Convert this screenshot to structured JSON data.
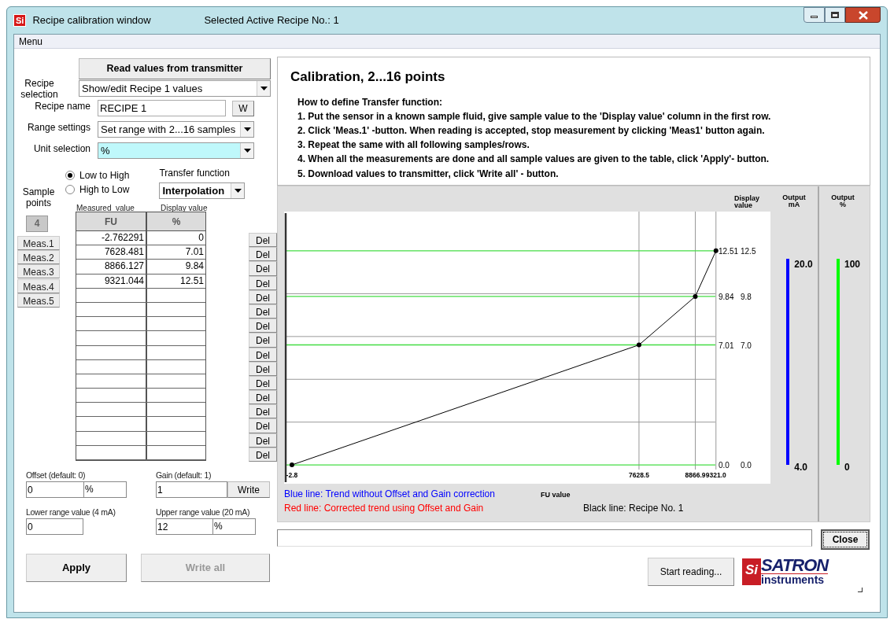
{
  "window": {
    "logo": "Si",
    "title": "Recipe calibration window",
    "subtitle": "Selected Active Recipe No.: 1"
  },
  "menu": [
    "Menu"
  ],
  "read_button": "Read values from transmitter",
  "fields": [
    {
      "kind": "select",
      "label": "Recipe selection",
      "value": "Show/edit Recipe 1 values"
    },
    {
      "kind": "input",
      "label": "Recipe name",
      "value": "RECIPE 1",
      "button": "W"
    },
    {
      "kind": "select",
      "label": "Range settings",
      "value": "Set range with 2...16 samples"
    },
    {
      "kind": "select",
      "label": "Unit selection",
      "value": "%",
      "highlighted": true
    }
  ],
  "direction": [
    {
      "label": "Low to High",
      "selected": true
    },
    {
      "label": "High to Low",
      "selected": false
    }
  ],
  "transfer_function": {
    "label": "Transfer function",
    "value": "Interpolation"
  },
  "sample_points": {
    "label": "Sample points",
    "value": "4"
  },
  "table": {
    "columns": [
      {
        "title": "Measured  value",
        "unit": "FU"
      },
      {
        "title": "Display value",
        "unit": "%"
      }
    ],
    "rows": [
      {
        "meas_button": "Meas.1",
        "measured": "-2.762291",
        "display": "0",
        "delete_button": "Del"
      },
      {
        "meas_button": "Meas.2",
        "measured": "7628.481",
        "display": "7.01",
        "delete_button": "Del"
      },
      {
        "meas_button": "Meas.3",
        "measured": "8866.127",
        "display": "9.84",
        "delete_button": "Del"
      },
      {
        "meas_button": "Meas.4",
        "measured": "9321.044",
        "display": "12.51",
        "delete_button": "Del"
      },
      {
        "meas_button": "Meas.5",
        "delete_button": "Del"
      },
      {
        "delete_button": "Del"
      },
      {
        "delete_button": "Del"
      },
      {
        "delete_button": "Del"
      },
      {
        "delete_button": "Del"
      },
      {
        "delete_button": "Del"
      },
      {
        "delete_button": "Del"
      },
      {
        "delete_button": "Del"
      },
      {
        "delete_button": "Del"
      },
      {
        "delete_button": "Del"
      },
      {
        "delete_button": "Del"
      },
      {
        "delete_button": "Del"
      }
    ]
  },
  "offset": {
    "label": "Offset (default: 0)",
    "value": "0",
    "unit": "%"
  },
  "gain": {
    "label": "Gain (default: 1)",
    "value": "1",
    "button": "Write"
  },
  "lower_range": {
    "label": "Lower range value (4 mA)",
    "value": "0"
  },
  "upper_range": {
    "label": "Upper range value (20 mA)",
    "value": "12",
    "unit": "%"
  },
  "actions": [
    {
      "label": "Apply",
      "disabled": false
    },
    {
      "label": "Write all",
      "disabled": true
    }
  ],
  "instructions": {
    "title": "Calibration, 2...16 points",
    "heading": "How to define Transfer function:",
    "steps": [
      "1. Put the sensor in a known sample fluid, give sample value to the 'Display value' column in the first row.",
      "2. Click 'Meas.1' -button. When reading is accepted, stop measurement by clicking 'Meas1' button again.",
      "3. Repeat the same with all following samples/rows.",
      "4. When all the measurements are done and all sample values are given to the table, click 'Apply'- button.",
      "5. Download values to transmitter, click  'Write all' - button."
    ]
  },
  "chart": {
    "chart_data": {
      "type": "line",
      "xlabel": "FU value",
      "ylabel": "Display value",
      "x": [
        -2.762291,
        7628.481,
        8866.127,
        9321.044
      ],
      "series": [
        {
          "name": "Recipe No. 1",
          "color": "#000000",
          "marker": "circle",
          "values": [
            0,
            7.01,
            9.84,
            12.51
          ]
        }
      ],
      "xlim": [
        -123,
        10519
      ],
      "ylim": [
        -1.1,
        14.8
      ],
      "grid": true,
      "xticks": [
        {
          "value": -2.8,
          "label": "-2.8"
        },
        {
          "value": 7628.5,
          "label": "7628.5"
        },
        {
          "value": 8866.9,
          "label": "8866.9"
        },
        {
          "value": 9321.0,
          "label": "9321.0"
        }
      ],
      "yticks": [
        {
          "value": 0,
          "label": "0.0"
        },
        {
          "value": 7.01,
          "label": "7.01"
        },
        {
          "value": 9.84,
          "label": "9.84"
        },
        {
          "value": 12.51,
          "label": "12.51"
        }
      ],
      "annotations": [
        "0.0",
        "7.0",
        "9.8",
        "12.5"
      ]
    },
    "legend": [
      {
        "text": "Blue line: Trend without Offset and Gain correction",
        "color": "#0000ff"
      },
      {
        "text": "Red line: Corrected trend using Offset and Gain",
        "color": "#ff0000"
      },
      {
        "text": "Black line:",
        "color": "#000000"
      }
    ]
  },
  "outputs": [
    {
      "title": [
        "Output",
        "mA"
      ],
      "max": "20.0",
      "min": "4.0",
      "color": "#0000ff"
    },
    {
      "title": [
        "Output",
        "%"
      ],
      "max": "100",
      "min": "0",
      "color": "#00ff00"
    }
  ],
  "close_button": "Close",
  "start_button": "Start reading...",
  "brand": {
    "mark": "Si",
    "name": "SATRON",
    "sub": "instruments"
  }
}
